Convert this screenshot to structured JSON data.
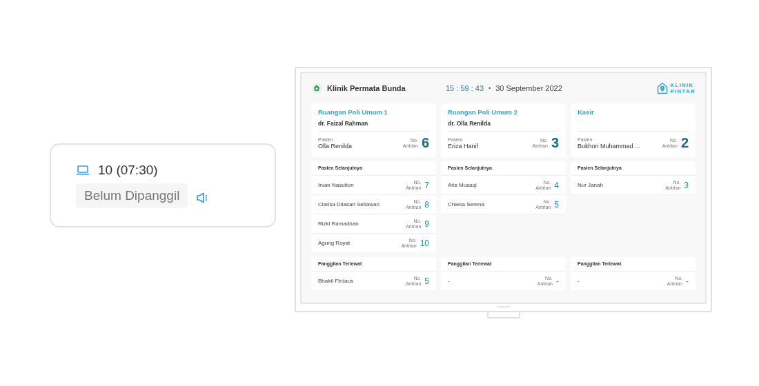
{
  "ticket": {
    "queue": "10 (07:30)",
    "status": "Belum Dipanggil"
  },
  "display": {
    "clinic": "Klinik Permata Bunda",
    "time": "15 : 59 : 43",
    "separator": "•",
    "date": "30 September 2022",
    "brand": [
      "KLINIK",
      "PINTAR"
    ],
    "columns": [
      {
        "room": "Ruangan Poli Umum 1",
        "doctor": "dr. Faizal Rahman",
        "patient_label": "Pasien",
        "patient": "Olla Renilda",
        "no_label": "No.",
        "antrian_label": "Antrian",
        "number": "6",
        "next": {
          "title": "Pasien Selanjutnya",
          "rows": [
            {
              "name": "Irvan Nasution",
              "no_label": "No.",
              "antrian_label": "Antrian",
              "number": "7"
            },
            {
              "name": "Clarisa Dilasari Setiawan",
              "no_label": "No.",
              "antrian_label": "Antrian",
              "number": "8"
            },
            {
              "name": "Rizki Ramadhan",
              "no_label": "No.",
              "antrian_label": "Antrian",
              "number": "9"
            },
            {
              "name": "Agung Royat",
              "no_label": "No.",
              "antrian_label": "Antrian",
              "number": "10"
            }
          ]
        },
        "missed": {
          "title": "Panggilan Terlewat",
          "rows": [
            {
              "name": "Bhakti Firdaus",
              "no_label": "No.",
              "antrian_label": "Antrian",
              "number": "5"
            }
          ]
        }
      },
      {
        "room": "Ruangan Poli Umum 2",
        "doctor": "dr. Olla Renilda",
        "patient_label": "Pasien",
        "patient": "Eriza Hanif",
        "no_label": "No.",
        "antrian_label": "Antrian",
        "number": "3",
        "next": {
          "title": "Pasien Selanjutnya",
          "rows": [
            {
              "name": "Aris Muzaqi",
              "no_label": "No.",
              "antrian_label": "Antrian",
              "number": "4"
            },
            {
              "name": "Chiesa Serena",
              "no_label": "No.",
              "antrian_label": "Antrian",
              "number": "5"
            }
          ]
        },
        "missed": {
          "title": "Panggilan Terlewat",
          "rows": [
            {
              "name": "-",
              "no_label": "No.",
              "antrian_label": "Antrian",
              "number": "-"
            }
          ]
        }
      },
      {
        "room": "Kasir",
        "patient_label": "Pasien",
        "patient": "Bukhori Muhammad ...",
        "no_label": "No.",
        "antrian_label": "Antrian",
        "number": "2",
        "next": {
          "title": "Pasien Selanjutnya",
          "rows": [
            {
              "name": "Nur Janah",
              "no_label": "No.",
              "antrian_label": "Antrian",
              "number": "3"
            }
          ]
        },
        "missed": {
          "title": "Panggilan Terlewat",
          "rows": [
            {
              "name": "-",
              "no_label": "No.",
              "antrian_label": "Antrian",
              "number": "-"
            }
          ]
        }
      }
    ]
  }
}
